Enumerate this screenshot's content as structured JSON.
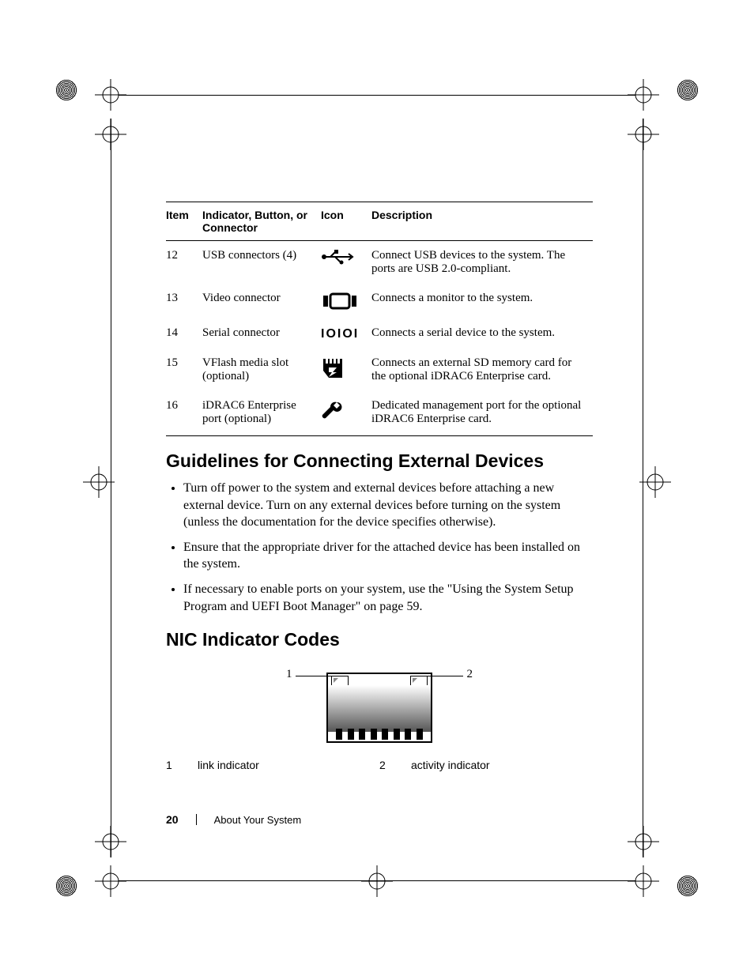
{
  "table": {
    "headers": {
      "item": "Item",
      "indicator": "Indicator, Button, or Connector",
      "icon": "Icon",
      "description": "Description"
    },
    "rows": [
      {
        "item": "12",
        "indicator": "USB connectors (4)",
        "icon": "usb-icon",
        "description": "Connect USB devices to the system. The ports are USB 2.0-compliant."
      },
      {
        "item": "13",
        "indicator": "Video connector",
        "icon": "video-icon",
        "description": "Connects a monitor to the system."
      },
      {
        "item": "14",
        "indicator": "Serial connector",
        "icon": "serial-icon",
        "description": "Connects a serial device to the system."
      },
      {
        "item": "15",
        "indicator": "VFlash media slot (optional)",
        "icon": "vflash-icon",
        "description": "Connects an external SD memory card for the optional iDRAC6 Enterprise card."
      },
      {
        "item": "16",
        "indicator": "iDRAC6 Enterprise port (optional)",
        "icon": "wrench-icon",
        "description": "Dedicated management port for the optional iDRAC6 Enterprise card."
      }
    ]
  },
  "sections": {
    "guidelines_title": "Guidelines for Connecting External Devices",
    "guidelines_items": [
      "Turn off power to the system and external devices before attaching a new external device. Turn on any external devices before turning on the system (unless the documentation for the device specifies otherwise).",
      "Ensure that the appropriate driver for the attached device has been installed on the system.",
      "If necessary to enable ports on your system, use the \"Using the System Setup Program and UEFI Boot Manager\" on page 59."
    ],
    "nic_title": "NIC Indicator Codes",
    "nic_callouts": [
      {
        "num": "1",
        "label": "link indicator"
      },
      {
        "num": "2",
        "label": "activity indicator"
      }
    ],
    "nic_figure_labels": {
      "n1": "1",
      "n2": "2"
    }
  },
  "footer": {
    "page_number": "20",
    "section_name": "About Your System"
  }
}
